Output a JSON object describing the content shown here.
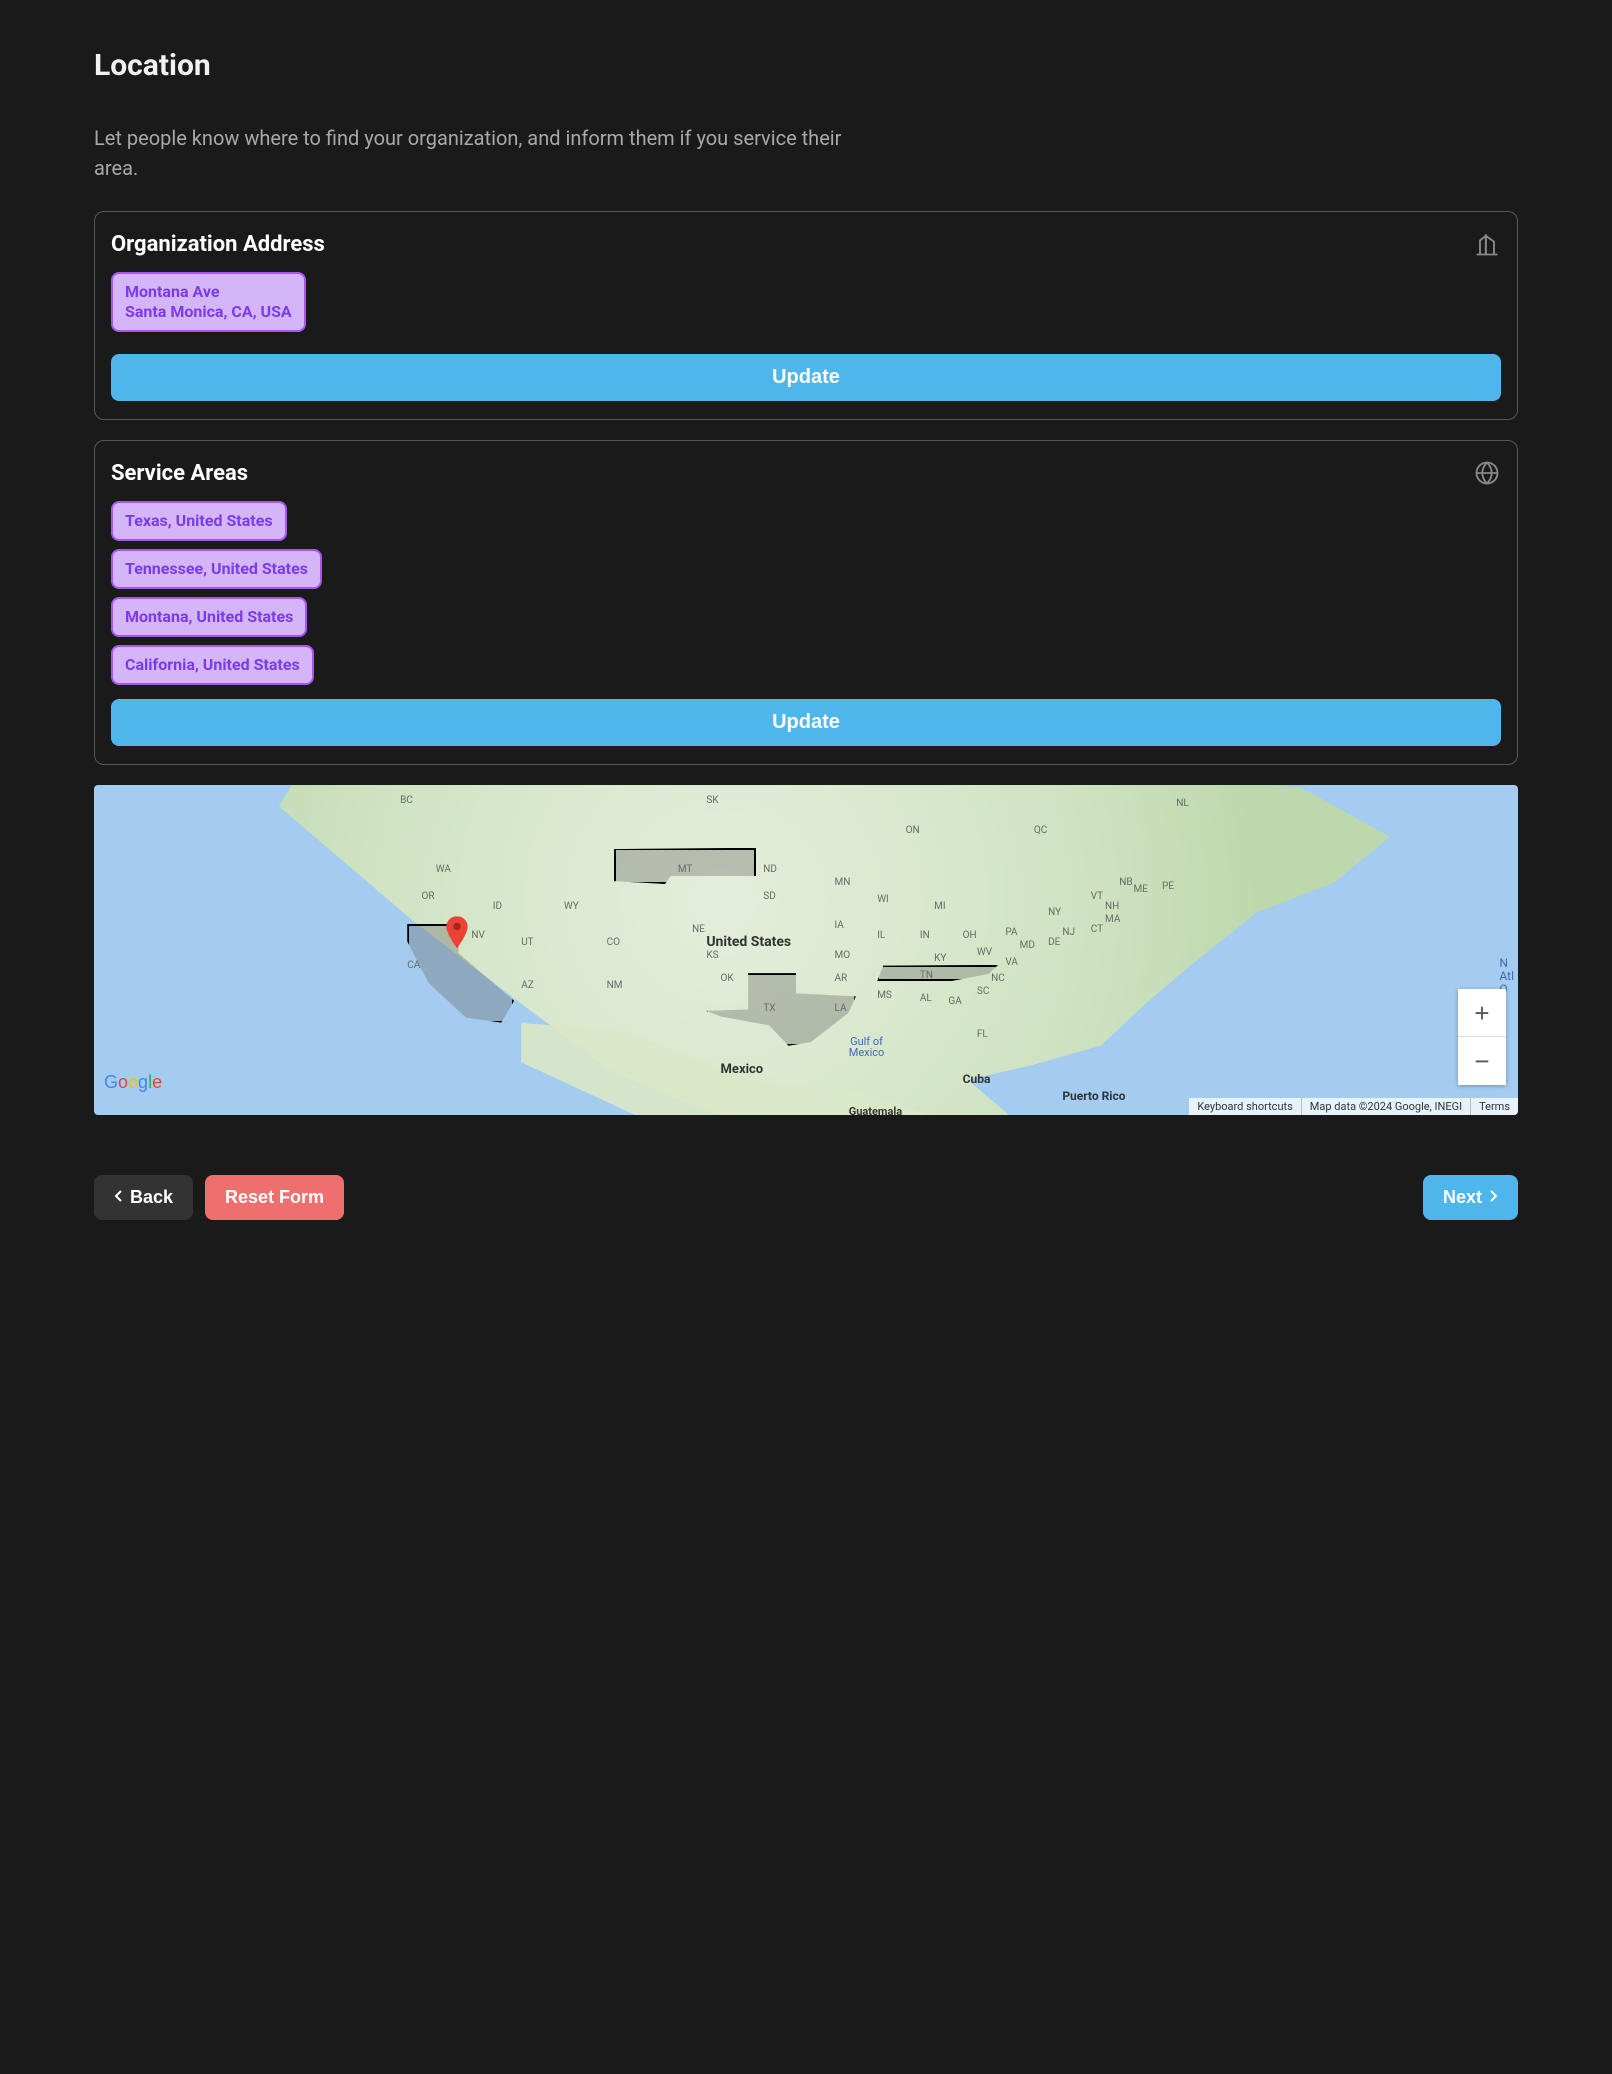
{
  "page": {
    "title": "Location",
    "description": "Let people know where to find your organization, and inform them if you service their area."
  },
  "addressCard": {
    "title": "Organization Address",
    "address_line1": "Montana Ave",
    "address_line2": "Santa Monica, CA, USA",
    "updateLabel": "Update"
  },
  "serviceCard": {
    "title": "Service Areas",
    "areas": [
      "Texas, United States",
      "Tennessee, United States",
      "Montana, United States",
      "California, United States"
    ],
    "updateLabel": "Update"
  },
  "map": {
    "centerLabel": "United States",
    "mexico": "Mexico",
    "cuba": "Cuba",
    "puertoRico": "Puerto Rico",
    "guatemala": "Guatemala",
    "gulf": "Gulf of\nMexico",
    "oceanNote": "N\nAtl\nO",
    "googleLogo": "Google",
    "keyboardShortcuts": "Keyboard shortcuts",
    "attribution": "Map data ©2024 Google, INEGI",
    "terms": "Terms",
    "zoomIn": "+",
    "zoomOut": "−",
    "provinces": {
      "BC": "BC",
      "SK": "SK",
      "ON": "ON",
      "QC": "QC",
      "NL": "NL",
      "NB": "NB",
      "PE": "PE"
    },
    "states": {
      "WA": "WA",
      "MT": "MT",
      "ND": "ND",
      "MN": "MN",
      "OR": "OR",
      "ID": "ID",
      "WY": "WY",
      "SD": "SD",
      "WI": "WI",
      "MI": "MI",
      "NY": "NY",
      "ME": "ME",
      "VT": "VT",
      "NH": "NH",
      "MA": "MA",
      "NV": "NV",
      "UT": "UT",
      "CO": "CO",
      "NE": "NE",
      "IA": "IA",
      "IL": "IL",
      "IN": "IN",
      "OH": "OH",
      "PA": "PA",
      "NJ": "NJ",
      "CT": "CT",
      "DE": "DE",
      "MD": "MD",
      "CA": "CA",
      "AZ": "AZ",
      "NM": "NM",
      "KS": "KS",
      "MO": "MO",
      "KY": "KY",
      "WV": "WV",
      "VA": "VA",
      "OK": "OK",
      "AR": "AR",
      "TN": "TN",
      "NC": "NC",
      "TX": "TX",
      "LA": "LA",
      "MS": "MS",
      "AL": "AL",
      "GA": "GA",
      "SC": "SC",
      "FL": "FL"
    }
  },
  "nav": {
    "back": "Back",
    "reset": "Reset Form",
    "next": "Next"
  }
}
